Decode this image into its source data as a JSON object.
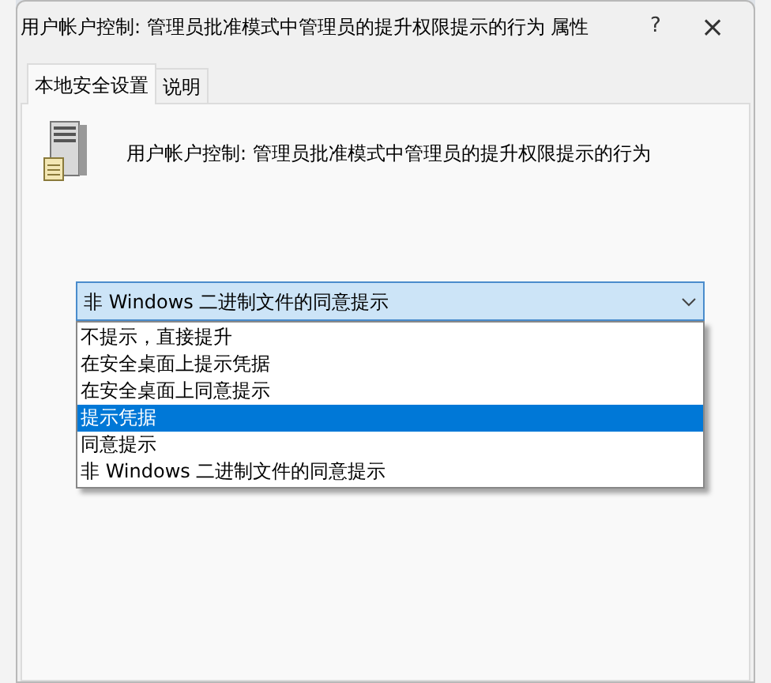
{
  "window": {
    "title": "用户帐户控制: 管理员批准模式中管理员的提升权限提示的行为 属性",
    "help": "?",
    "close": "×"
  },
  "tabs": [
    {
      "label": "本地安全设置",
      "selected": true
    },
    {
      "label": "说明",
      "selected": false
    }
  ],
  "policy": {
    "title": "用户帐户控制: 管理员批准模式中管理员的提升权限提示的行为"
  },
  "dropdown": {
    "value": "非 Windows 二进制文件的同意提示",
    "expanded": true,
    "options": [
      {
        "label": "不提示，直接提升",
        "highlighted": false
      },
      {
        "label": "在安全桌面上提示凭据",
        "highlighted": false
      },
      {
        "label": "在安全桌面上同意提示",
        "highlighted": false
      },
      {
        "label": "提示凭据",
        "highlighted": true
      },
      {
        "label": "同意提示",
        "highlighted": false
      },
      {
        "label": "非 Windows 二进制文件的同意提示",
        "highlighted": false
      }
    ]
  }
}
